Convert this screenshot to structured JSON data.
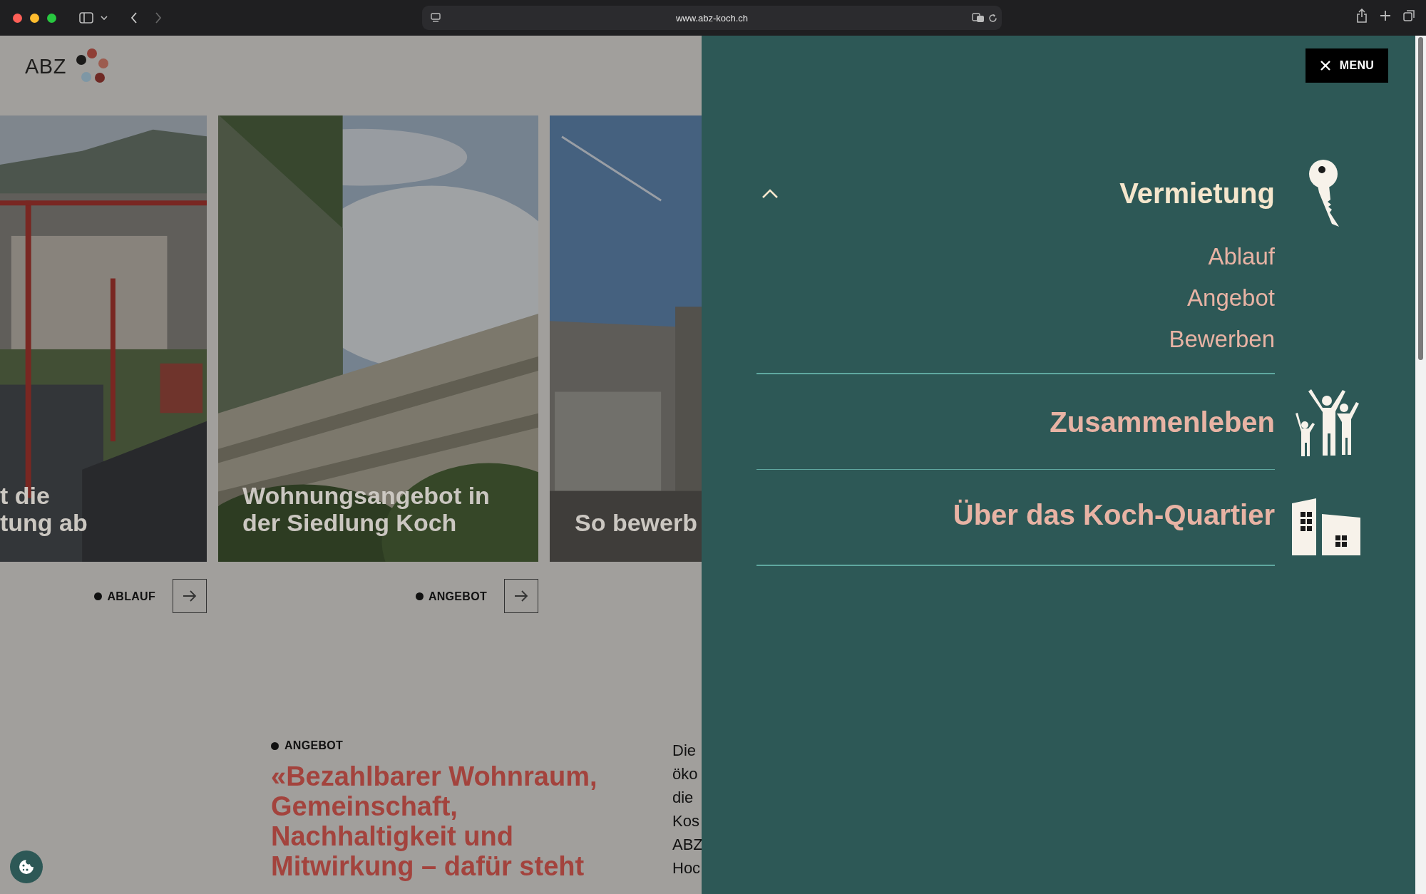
{
  "browser": {
    "url": "www.abz-koch.ch"
  },
  "page": {
    "logo": "ABZ",
    "cards": [
      {
        "title_lines": [
          "t die",
          "tung ab"
        ],
        "link": "ABLAUF"
      },
      {
        "title_lines": [
          "Wohnungsangebot in",
          "der Siedlung Koch"
        ],
        "link": "ANGEBOT"
      },
      {
        "title_lines": [
          "So bewerb"
        ]
      }
    ],
    "article": {
      "tag": "ANGEBOT",
      "headline_lines": [
        "«Bezahlbarer Wohnraum,",
        "Gemeinschaft,",
        "Nachhaltigkeit und",
        "Mitwirkung – dafür steht"
      ],
      "side_text_lines": [
        "Die",
        "öko",
        "die",
        "Kos",
        "ABZ",
        "Hoc"
      ]
    }
  },
  "menu": {
    "close_label": "MENU",
    "sections": [
      {
        "title": "Vermietung",
        "expanded": true,
        "items": [
          "Ablauf",
          "Angebot",
          "Bewerben"
        ]
      },
      {
        "title": "Zusammenleben",
        "expanded": false
      },
      {
        "title": "Über das Koch-Quartier",
        "expanded": false
      }
    ]
  }
}
